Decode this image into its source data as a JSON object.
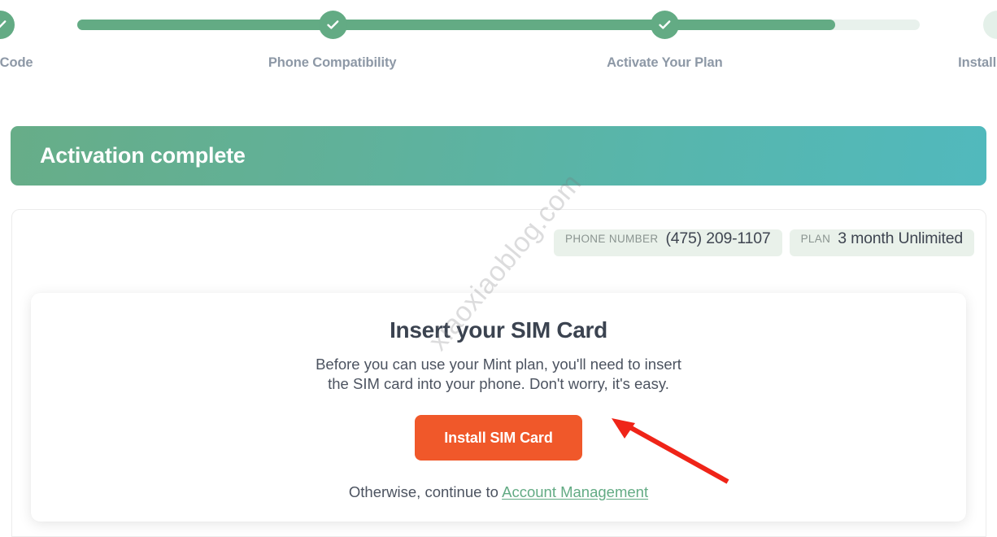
{
  "stepper": {
    "progress_percent": 90,
    "fill_color": "#63ab84",
    "track_color": "#e8f1ec",
    "check_icon": "check-icon",
    "steps": [
      {
        "label": "Enter ACT Code",
        "state": "complete"
      },
      {
        "label": "Phone Compatibility",
        "state": "complete"
      },
      {
        "label": "Activate Your Plan",
        "state": "complete"
      },
      {
        "label": "Install SIM or eSIM",
        "state": "pending"
      }
    ]
  },
  "banner": {
    "title": "Activation complete",
    "gradient_from": "#67ad88",
    "gradient_to": "#51b9bd"
  },
  "summary": {
    "badges": [
      {
        "key": "PHONE NUMBER",
        "value": "(475) 209-1107"
      },
      {
        "key": "PLAN",
        "value": "3 month Unlimited"
      }
    ],
    "badge_bg": "#e9f1ea"
  },
  "sim_card": {
    "title": "Insert your SIM Card",
    "description_line1": "Before you can use your Mint plan, you'll need to insert",
    "description_line2": "the SIM card into your phone. Don't worry, it's easy.",
    "install_button": "Install SIM Card",
    "install_button_color": "#f0582a",
    "otherwise_prefix": "Otherwise, continue to ",
    "account_link": "Account Management",
    "account_link_color": "#63ab84"
  },
  "annotation": {
    "arrow": "red-arrow-pointing-to-install-button",
    "arrow_color": "#ef2418"
  },
  "watermark": {
    "text": "xiaoxiaoblog.com"
  }
}
